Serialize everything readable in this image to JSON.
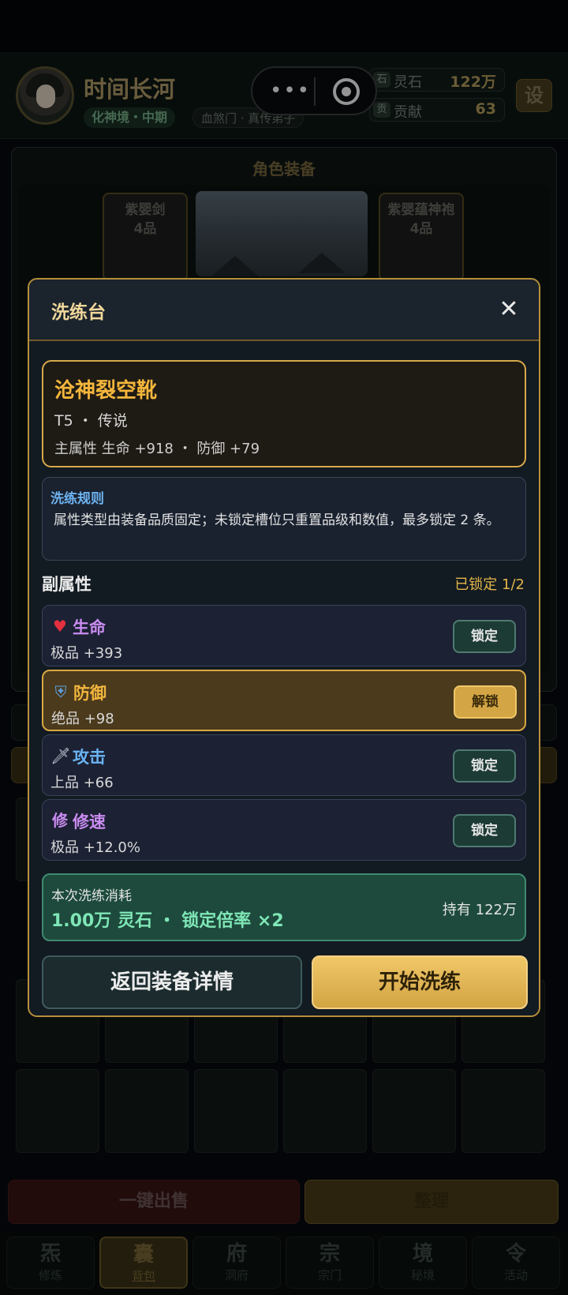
{
  "header": {
    "player_name": "时间长河",
    "realm": "化神境・中期",
    "sect": "血煞门 · 真传弟子",
    "resources": [
      {
        "icon_glyph": "石",
        "label": "灵石",
        "value": "122万"
      },
      {
        "icon_glyph": "贡",
        "label": "贡献",
        "value": "63"
      }
    ],
    "settings_label": "设",
    "capsule_dots": "•••"
  },
  "equipment": {
    "title": "角色装备",
    "slots": [
      {
        "name": "紫婴剑",
        "grade": "4品"
      },
      {
        "name": "紫婴蕴神袍",
        "grade": "4品"
      }
    ]
  },
  "bottom_actions": {
    "sell_all": "一键出售",
    "sort": "整理"
  },
  "tabs": [
    {
      "glyph": "炁",
      "label": "修炼"
    },
    {
      "glyph": "囊",
      "label": "背包",
      "active": true
    },
    {
      "glyph": "府",
      "label": "洞府"
    },
    {
      "glyph": "宗",
      "label": "宗门"
    },
    {
      "glyph": "境",
      "label": "秘境"
    },
    {
      "glyph": "令",
      "label": "活动"
    }
  ],
  "modal": {
    "title": "洗练台",
    "close_glyph": "✕",
    "item": {
      "name": "沧神裂空靴",
      "tier": "T5 ・ 传说",
      "main_attr": "主属性  生命 +918  ・  防御 +79"
    },
    "rules": {
      "title": "洗练规则",
      "text": "属性类型由装备品质固定；未锁定槽位只重置品级和数值，最多锁定 2 条。"
    },
    "sub_attrs_title": "副属性",
    "lock_count": "已锁定 1/2",
    "attrs": [
      {
        "icon": "heart-icon",
        "icon_glyph": "♥",
        "name": "生命",
        "value": "极品 +393",
        "color": "#c98cf0",
        "locked": false,
        "button": "锁定"
      },
      {
        "icon": "shield-icon",
        "icon_glyph": "⛨",
        "name": "防御",
        "value": "绝品 +98",
        "color": "#f2b53e",
        "locked": true,
        "button": "解锁"
      },
      {
        "icon": "dagger-icon",
        "icon_glyph": "🗡",
        "name": "攻击",
        "value": "上品 +66",
        "color": "#6ab3f3",
        "locked": false,
        "button": "锁定"
      },
      {
        "icon": "xiu-icon",
        "icon_glyph": "修",
        "name": "修速",
        "value": "极品 +12.0%",
        "color": "#c98cf0",
        "locked": false,
        "button": "锁定"
      }
    ],
    "cost": {
      "label": "本次洗练消耗",
      "value": "1.00万 灵石  ・  锁定倍率 ×2",
      "hold": "持有 122万"
    },
    "back_button": "返回装备详情",
    "start_button": "开始洗练"
  },
  "colors": {
    "accent_gold": "#d7a94a",
    "cost_green": "#7fe6b6",
    "rule_blue": "#6db3f0"
  }
}
